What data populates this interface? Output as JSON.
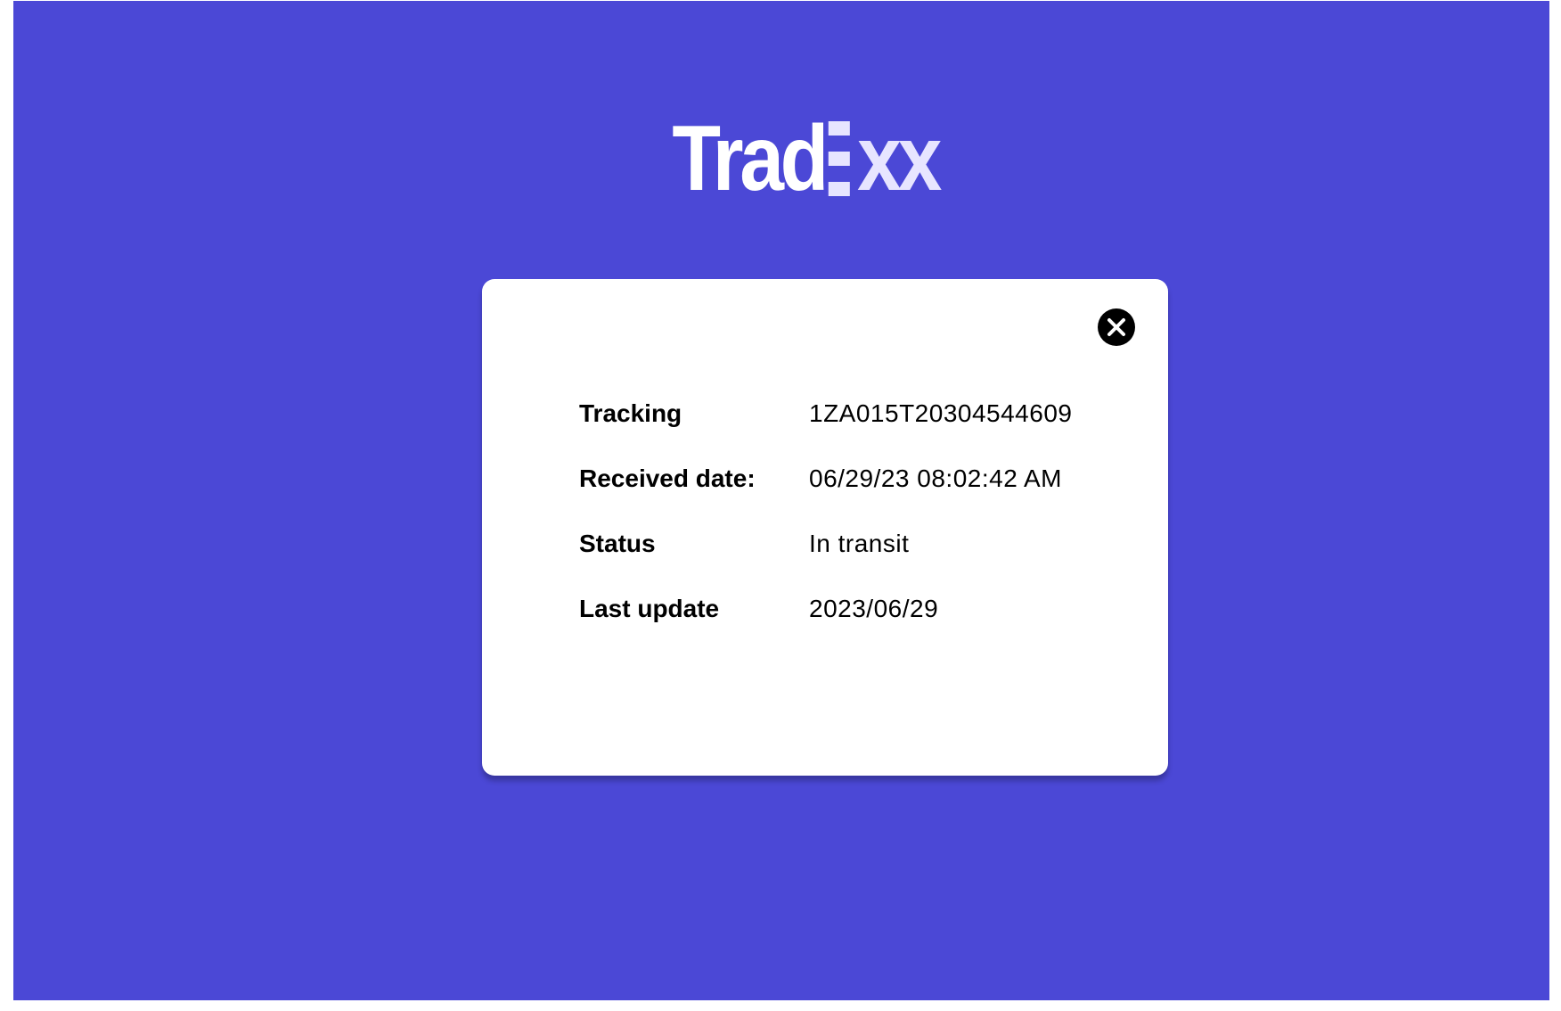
{
  "brand": {
    "logo_prefix": "Trad",
    "logo_suffix": "xx",
    "logo_icon": "stacked-bars-e-icon",
    "colors": {
      "background": "#4B48D6",
      "logo_text": "#FFFFFF",
      "logo_accent": "#E7E5FF",
      "card": "#FFFFFF",
      "close_button": "#000000"
    }
  },
  "dialog": {
    "close_icon": "close-icon",
    "rows": [
      {
        "label": "Tracking",
        "value": "1ZA015T20304544609"
      },
      {
        "label": "Received date:",
        "value": "06/29/23 08:02:42 AM"
      },
      {
        "label": "Status",
        "value": "In transit"
      },
      {
        "label": "Last update",
        "value": "2023/06/29"
      }
    ]
  }
}
